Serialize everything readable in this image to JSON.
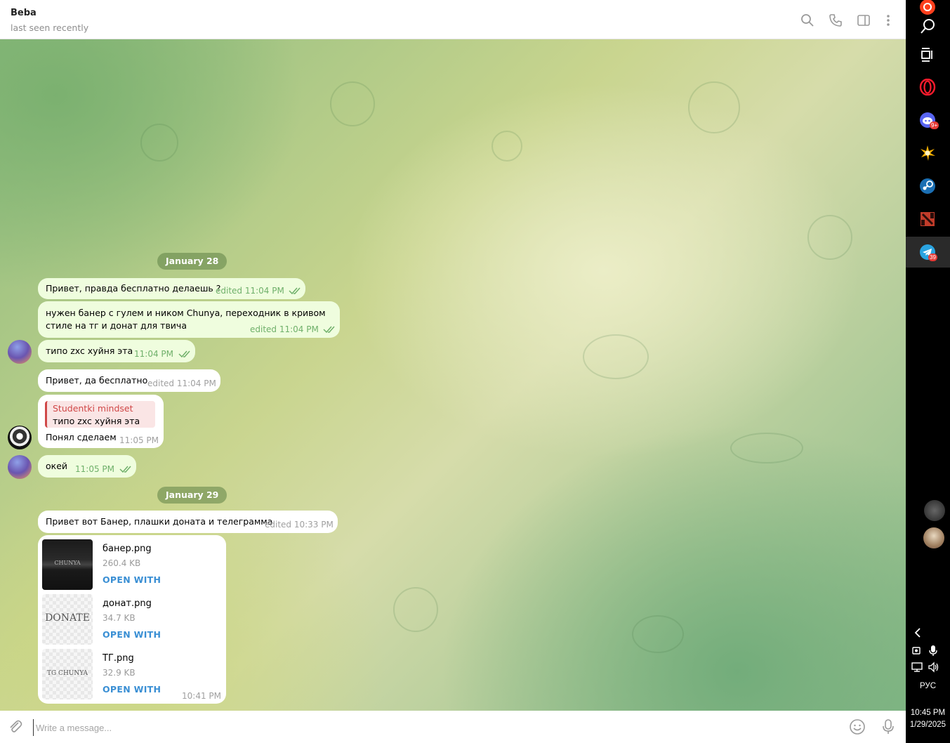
{
  "header": {
    "name": "Beba",
    "status": "last seen recently"
  },
  "dates": {
    "d1": "January 28",
    "d2": "January 29"
  },
  "messages": [
    {
      "text": "Привет, правда бесплатно делаешь ?",
      "meta": "edited 11:04 PM"
    },
    {
      "text_line1": "нужен банер с гулем и ником Chunya, переходник в кривом",
      "text_line2": "стиле на тг и донат для твича",
      "meta": "edited 11:04 PM"
    },
    {
      "text": "типо zxc хуйня эта",
      "meta": "11:04 PM"
    },
    {
      "text": "Привет, да бесплатно",
      "meta": "edited 11:04 PM"
    },
    {
      "reply_name": "Studentki mindset",
      "reply_text": "типо zxc хуйня эта",
      "text": "Понял сделаем",
      "meta": "11:05 PM"
    },
    {
      "text": "окей",
      "meta": "11:05 PM"
    },
    {
      "text": "Привет вот Банер, плашки доната и телеграмма",
      "meta": "edited 10:33 PM"
    }
  ],
  "files": [
    {
      "name": "банер.png",
      "size": "260.4 KB",
      "action": "OPEN WITH",
      "thumb_text": "CHUNYA"
    },
    {
      "name": "донат.png",
      "size": "34.7 KB",
      "action": "OPEN WITH",
      "thumb_text": "DONATE"
    },
    {
      "name": "ТГ.png",
      "size": "32.9 KB",
      "action": "OPEN WITH",
      "thumb_text": "TG CHUNYA"
    }
  ],
  "files_time": "10:41 PM",
  "composer": {
    "placeholder": "Write a message..."
  },
  "taskbar": {
    "badges": {
      "discord": "9+",
      "telegram": "39"
    },
    "lang": "РУС",
    "time": "10:45 PM",
    "date": "1/29/2025"
  },
  "colors": {
    "outgoing_bubble": "#effdde",
    "accent": "#3a8fd4",
    "check": "#6fb06a"
  }
}
